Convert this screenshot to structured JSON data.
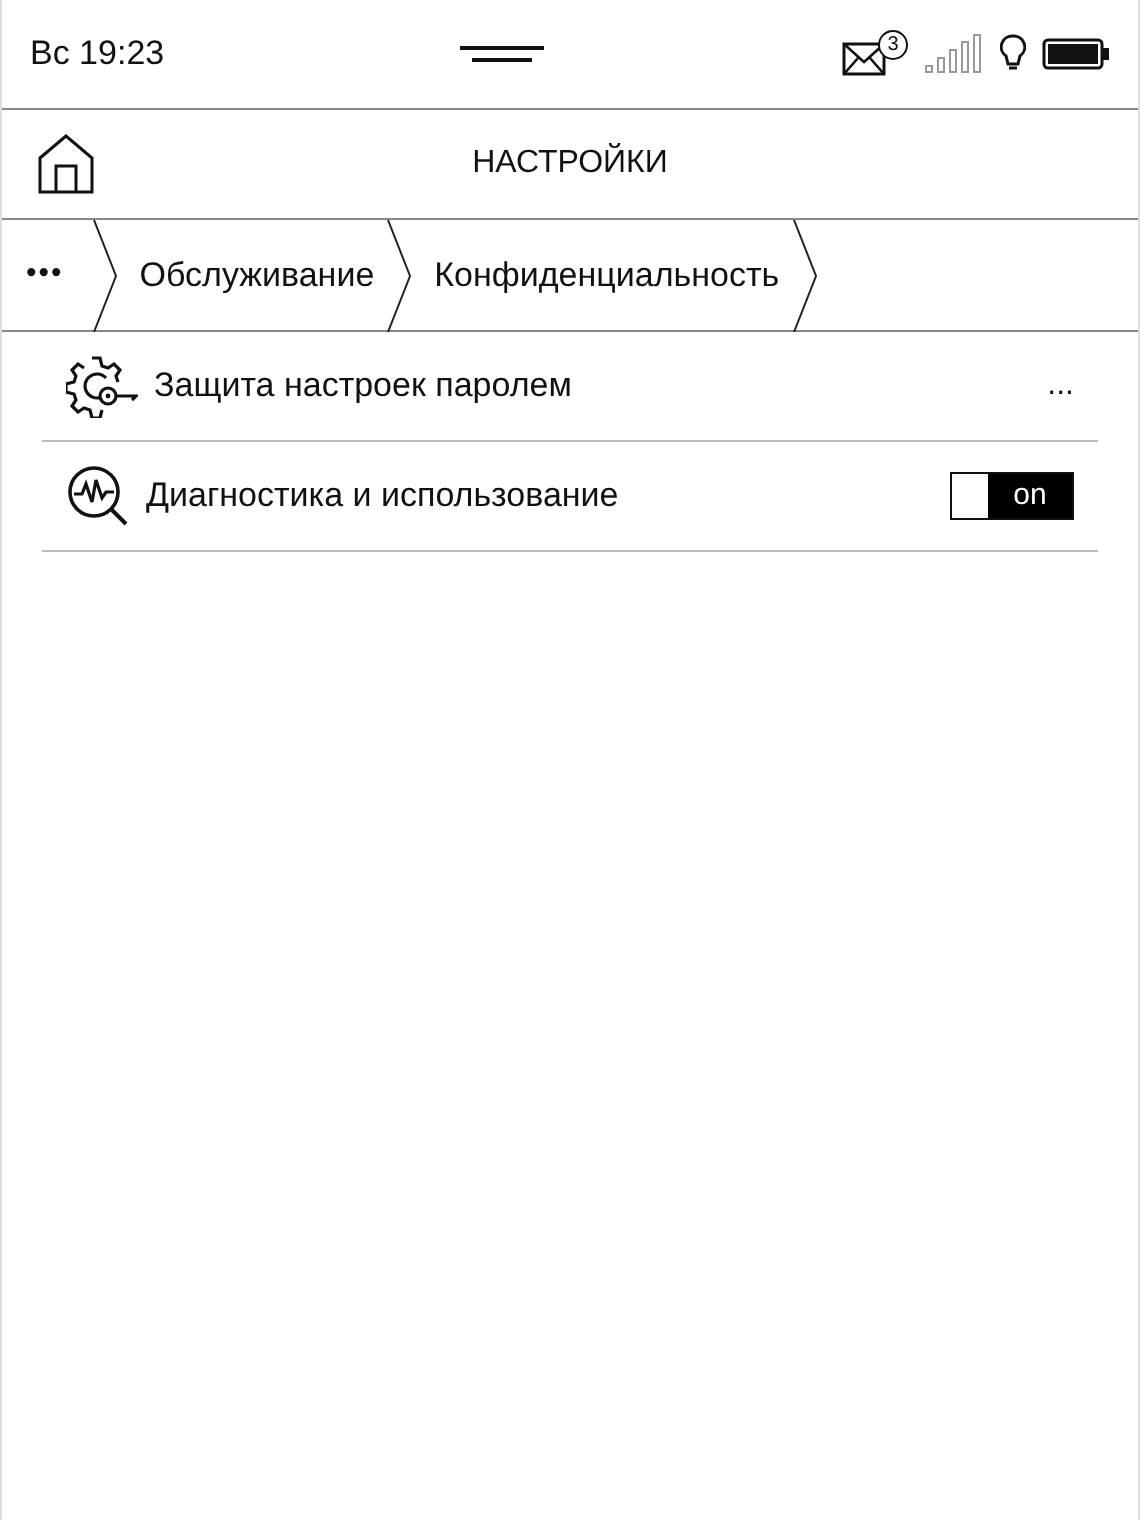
{
  "status_bar": {
    "time": "Вс 19:23",
    "mail_count": "3"
  },
  "header": {
    "title": "НАСТРОЙКИ"
  },
  "breadcrumbs": [
    {
      "label": "•••"
    },
    {
      "label": "Обслуживание"
    },
    {
      "label": "Конфиденциальность"
    }
  ],
  "settings": [
    {
      "kind": "value",
      "label": "Защита настроек паролем",
      "value": "..."
    },
    {
      "kind": "toggle",
      "label": "Диагностика и использование",
      "on": true,
      "toggle_label": "on"
    }
  ]
}
